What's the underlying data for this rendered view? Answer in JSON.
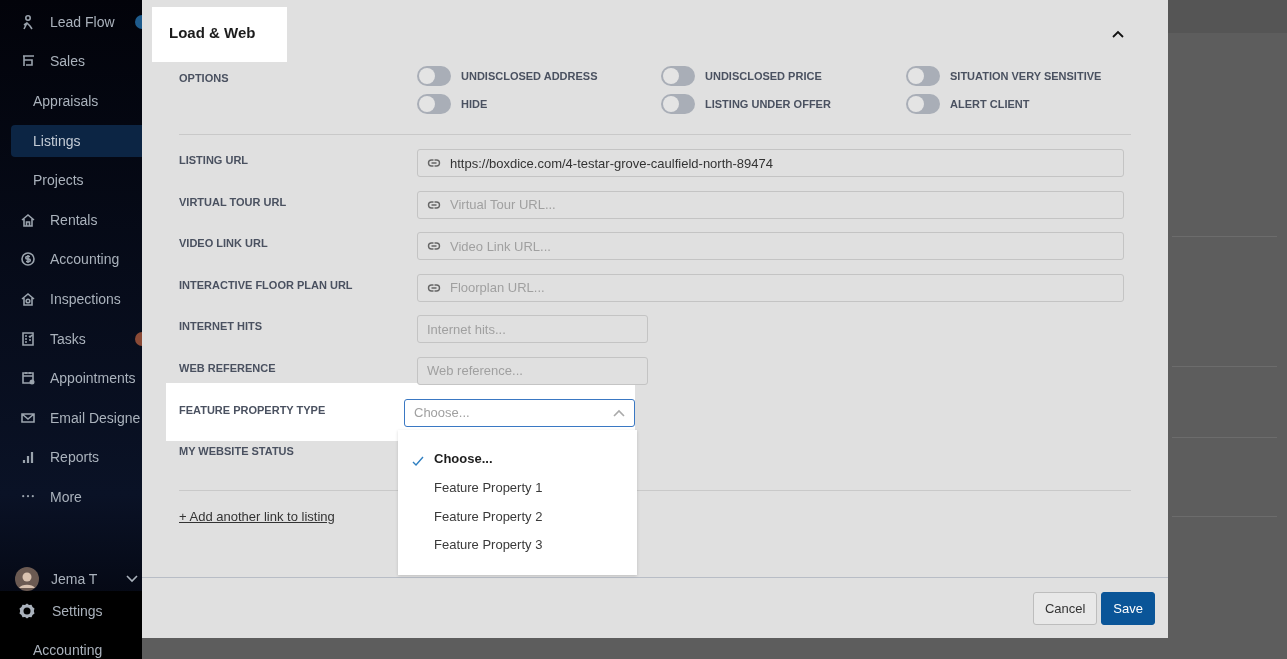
{
  "sidebar": {
    "items": [
      {
        "label": "Lead Flow",
        "kind": "main",
        "selected": false,
        "color": "#1e5b8c"
      },
      {
        "label": "Sales",
        "kind": "main",
        "selected": false
      },
      {
        "label": "Appraisals",
        "kind": "sub",
        "selected": false
      },
      {
        "label": "Listings",
        "kind": "sub",
        "selected": true
      },
      {
        "label": "Projects",
        "kind": "sub",
        "selected": false
      },
      {
        "label": "Rentals",
        "kind": "main",
        "selected": false
      },
      {
        "label": "Accounting",
        "kind": "main",
        "selected": false
      },
      {
        "label": "Inspections",
        "kind": "main",
        "selected": false
      },
      {
        "label": "Tasks",
        "kind": "main",
        "selected": false,
        "color": "#8a4a36"
      },
      {
        "label": "Appointments",
        "kind": "main",
        "selected": false
      },
      {
        "label": "Email Designe",
        "kind": "main",
        "selected": false
      },
      {
        "label": "Reports",
        "kind": "main",
        "selected": false
      },
      {
        "label": "More",
        "kind": "main",
        "selected": false
      }
    ],
    "user": {
      "name": "Jema T"
    },
    "settings": {
      "label": "Settings"
    },
    "sub_items": [
      {
        "label": "Accounting",
        "selected": false
      }
    ]
  },
  "modal": {
    "title": "Load & Web",
    "options_label": "OPTIONS",
    "options": [
      {
        "label": "UNDISCLOSED ADDRESS",
        "on": false
      },
      {
        "label": "UNDISCLOSED PRICE",
        "on": false
      },
      {
        "label": "SITUATION VERY SENSITIVE",
        "on": false
      },
      {
        "label": "HIDE",
        "on": false
      },
      {
        "label": "LISTING UNDER OFFER",
        "on": false
      },
      {
        "label": "ALERT CLIENT",
        "on": false
      }
    ],
    "fields": [
      {
        "label": "LISTING URL",
        "kind": "url",
        "value": "https://boxdice.com/4-testar-grove-caulfield-north-89474"
      },
      {
        "label": "VIRTUAL TOUR URL",
        "kind": "url",
        "placeholder": "Virtual Tour URL..."
      },
      {
        "label": "VIDEO LINK URL",
        "kind": "url",
        "placeholder": "Video Link URL..."
      },
      {
        "label": "INTERACTIVE FLOOR PLAN URL",
        "kind": "url",
        "placeholder": "Floorplan URL..."
      },
      {
        "label": "INTERNET HITS",
        "kind": "text",
        "placeholder": "Internet hits..."
      },
      {
        "label": "WEB REFERENCE",
        "kind": "text",
        "placeholder": "Web reference..."
      },
      {
        "label": "FEATURE PROPERTY TYPE",
        "kind": "select",
        "placeholder": "Choose...",
        "expanded": true,
        "options": [
          {
            "label": "Choose...",
            "selected": true
          },
          {
            "label": "Feature Property 1",
            "selected": false
          },
          {
            "label": "Feature Property 2",
            "selected": false
          },
          {
            "label": "Feature Property 3",
            "selected": false
          }
        ]
      },
      {
        "label": "MY WEBSITE STATUS",
        "kind": "label"
      }
    ],
    "add_link": "+ Add another link to listing",
    "buttons": [
      {
        "label": "Cancel",
        "kind": "secondary"
      },
      {
        "label": "Save",
        "kind": "primary"
      }
    ]
  }
}
